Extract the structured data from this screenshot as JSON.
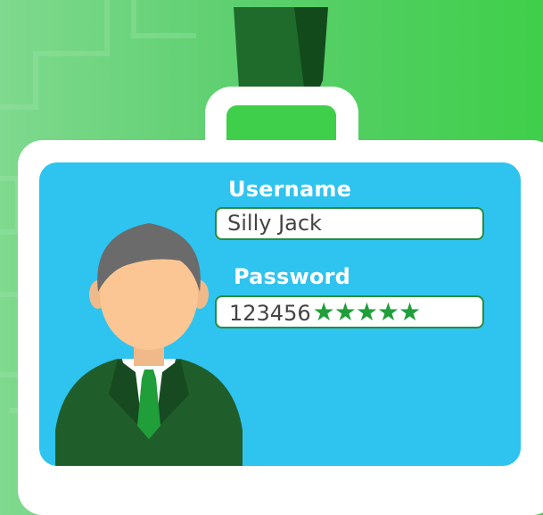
{
  "username": {
    "label": "Username",
    "value": "Silly Jack"
  },
  "password": {
    "label": "Password",
    "value": "123456",
    "masked": "★★★★★"
  },
  "colors": {
    "background": "#5ccf6e",
    "card": "#2fc3f0",
    "lanyard": "#1e6b2c",
    "suit": "#1f5e2a",
    "tie": "#1f9e3a",
    "field_border": "#2a8c3c"
  },
  "icons": [
    "person-avatar-icon"
  ]
}
